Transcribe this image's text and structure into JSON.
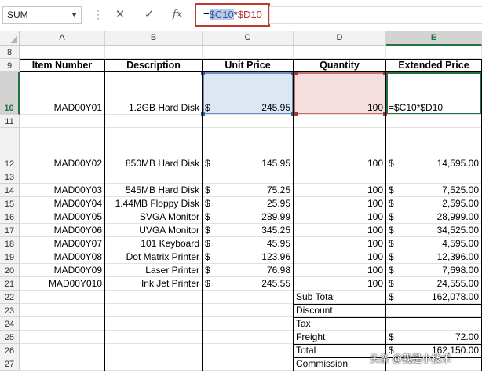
{
  "formula_bar": {
    "name_box": "SUM",
    "cancel_symbol": "✕",
    "enter_symbol": "✓",
    "fx_symbol": "fx",
    "formula_prefix": "=",
    "ref1": "$C10",
    "op": "*",
    "ref2": "$D10"
  },
  "columns": [
    "A",
    "B",
    "C",
    "D",
    "E"
  ],
  "selected_column": "E",
  "selected_row": "10",
  "headers": {
    "item_number": "Item Number",
    "description": "Description",
    "unit_price": "Unit Price",
    "quantity": "Quantity",
    "extended_price": "Extended Price"
  },
  "rows": [
    {
      "num": "8",
      "item": "",
      "desc": "",
      "cur": "",
      "price": "",
      "qty": "",
      "ecur": "",
      "ext": ""
    },
    {
      "num": "9",
      "item": "",
      "desc": "",
      "cur": "",
      "price": "",
      "qty": "",
      "ecur": "",
      "ext": ""
    },
    {
      "num": "10",
      "item": "MAD00Y01",
      "desc": "1.2GB Hard Disk",
      "cur": "$",
      "price": "245.95",
      "qty": "100",
      "ecur": "",
      "ext": "=$C10*$D10"
    },
    {
      "num": "11",
      "item": "",
      "desc": "",
      "cur": "",
      "price": "",
      "qty": "",
      "ecur": "",
      "ext": ""
    },
    {
      "num": "12",
      "item": "MAD00Y02",
      "desc": "850MB Hard Disk",
      "cur": "$",
      "price": "145.95",
      "qty": "100",
      "ecur": "$",
      "ext": "14,595.00"
    },
    {
      "num": "13",
      "item": "",
      "desc": "",
      "cur": "",
      "price": "",
      "qty": "",
      "ecur": "",
      "ext": ""
    },
    {
      "num": "14",
      "item": "MAD00Y03",
      "desc": "545MB Hard Disk",
      "cur": "$",
      "price": "75.25",
      "qty": "100",
      "ecur": "$",
      "ext": "7,525.00"
    },
    {
      "num": "15",
      "item": "MAD00Y04",
      "desc": "1.44MB Floppy Disk",
      "cur": "$",
      "price": "25.95",
      "qty": "100",
      "ecur": "$",
      "ext": "2,595.00"
    },
    {
      "num": "16",
      "item": "MAD00Y05",
      "desc": "SVGA Monitor",
      "cur": "$",
      "price": "289.99",
      "qty": "100",
      "ecur": "$",
      "ext": "28,999.00"
    },
    {
      "num": "17",
      "item": "MAD00Y06",
      "desc": "UVGA Monitor",
      "cur": "$",
      "price": "345.25",
      "qty": "100",
      "ecur": "$",
      "ext": "34,525.00"
    },
    {
      "num": "18",
      "item": "MAD00Y07",
      "desc": "101 Keyboard",
      "cur": "$",
      "price": "45.95",
      "qty": "100",
      "ecur": "$",
      "ext": "4,595.00"
    },
    {
      "num": "19",
      "item": "MAD00Y08",
      "desc": "Dot Matrix Printer",
      "cur": "$",
      "price": "123.96",
      "qty": "100",
      "ecur": "$",
      "ext": "12,396.00"
    },
    {
      "num": "20",
      "item": "MAD00Y09",
      "desc": "Laser Printer",
      "cur": "$",
      "price": "76.98",
      "qty": "100",
      "ecur": "$",
      "ext": "7,698.00"
    },
    {
      "num": "21",
      "item": "MAD00Y010",
      "desc": "Ink Jet Printer",
      "cur": "$",
      "price": "245.55",
      "qty": "100",
      "ecur": "$",
      "ext": "24,555.00"
    },
    {
      "num": "22",
      "item": "",
      "desc": "",
      "cur": "",
      "price": "",
      "qty": "Sub Total",
      "ecur": "$",
      "ext": "162,078.00"
    },
    {
      "num": "23",
      "item": "",
      "desc": "",
      "cur": "",
      "price": "",
      "qty": "Discount",
      "ecur": "",
      "ext": ""
    },
    {
      "num": "24",
      "item": "",
      "desc": "",
      "cur": "",
      "price": "",
      "qty": "Tax",
      "ecur": "",
      "ext": ""
    },
    {
      "num": "25",
      "item": "",
      "desc": "",
      "cur": "",
      "price": "",
      "qty": "Freight",
      "ecur": "$",
      "ext": "72.00"
    },
    {
      "num": "26",
      "item": "",
      "desc": "",
      "cur": "",
      "price": "",
      "qty": "Total",
      "ecur": "$",
      "ext": "162,150.00"
    },
    {
      "num": "27",
      "item": "",
      "desc": "",
      "cur": "",
      "price": "",
      "qty": "Commission",
      "ecur": "",
      "ext": ""
    }
  ],
  "watermark": "头条 @我是小技术",
  "colors": {
    "excel_green": "#217346",
    "ref_c_fill": "#dde7f4",
    "ref_d_fill": "#f6dede",
    "formula_box_border": "#c0392b"
  }
}
